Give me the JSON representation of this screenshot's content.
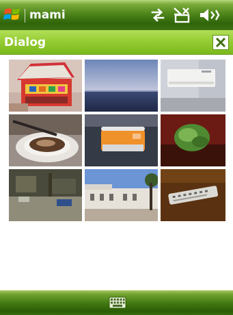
{
  "status_bar": {
    "owner_name": "mami",
    "icons": [
      "windows-start-icon",
      "sync-arrows-icon",
      "no-signal-icon",
      "speaker-mute-icon"
    ]
  },
  "dialog": {
    "title": "Dialog",
    "close_icon": "close-icon"
  },
  "thumbnails": [
    {
      "name": "thumb-candy-box"
    },
    {
      "name": "thumb-sea-horizon"
    },
    {
      "name": "thumb-air-conditioner"
    },
    {
      "name": "thumb-coffee-cup"
    },
    {
      "name": "thumb-orange-device"
    },
    {
      "name": "thumb-green-plant"
    },
    {
      "name": "thumb-street-scene"
    },
    {
      "name": "thumb-white-building"
    },
    {
      "name": "thumb-remote-control"
    }
  ],
  "soft_keys": {
    "center_icon": "keyboard-icon"
  },
  "colors": {
    "status_bar_green": "#3b7212",
    "title_bar_green": "#96cd34",
    "title_text": "#ffffff",
    "soft_bar_green": "#3f7611"
  }
}
